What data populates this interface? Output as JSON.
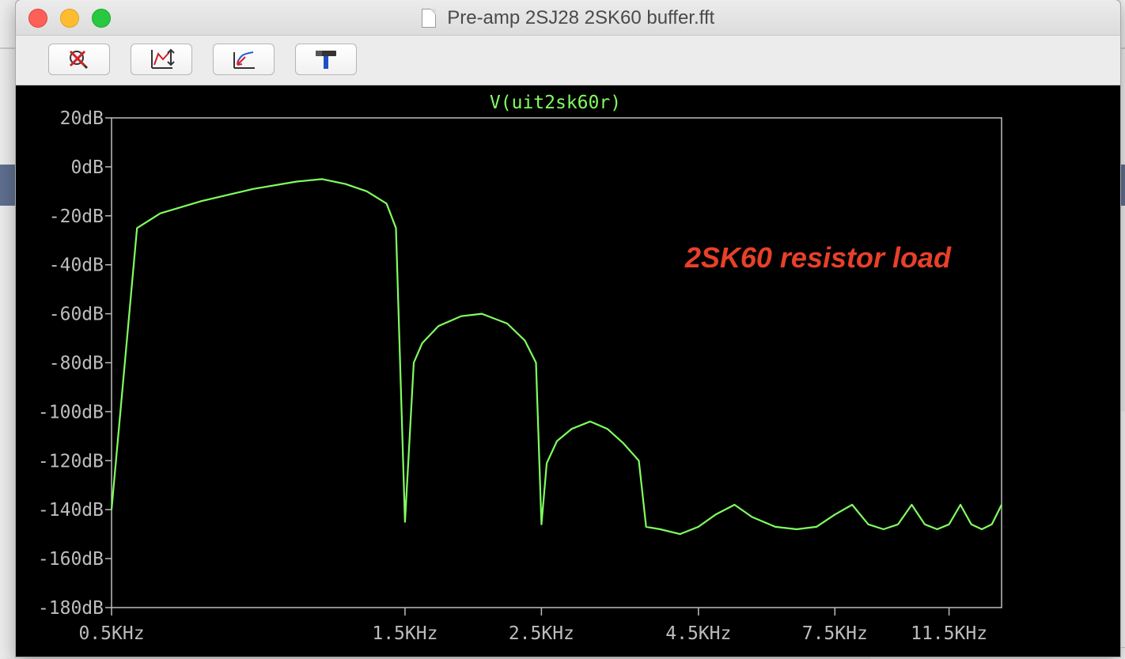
{
  "window": {
    "title": "Pre-amp 2SJ28 2SK60 buffer.fft"
  },
  "toolbar": {
    "buttons": [
      {
        "name": "zoom-cancel",
        "icon": "zoom-cancel-icon"
      },
      {
        "name": "autorange",
        "icon": "autorange-icon"
      },
      {
        "name": "pick-traces",
        "icon": "plot-traces-icon"
      },
      {
        "name": "settings",
        "icon": "hammer-icon"
      }
    ]
  },
  "colors": {
    "trace": "#80ff5f",
    "annotation": "#e8402a",
    "axis": "#bdbdbd",
    "background": "#000000"
  },
  "chart_data": {
    "type": "line",
    "title": "V(uit2sk60r)",
    "annotation": "2SK60 resistor load",
    "xlabel": "",
    "ylabel": "",
    "x_scale": "log",
    "xlim": [
      500,
      14000
    ],
    "ylim": [
      -180,
      20
    ],
    "grid": false,
    "y_ticks": [
      20,
      0,
      -20,
      -40,
      -60,
      -80,
      -100,
      -120,
      -140,
      -160,
      -180
    ],
    "y_tick_labels": [
      "20dB",
      "0dB",
      "-20dB",
      "-40dB",
      "-60dB",
      "-80dB",
      "-100dB",
      "-120dB",
      "-140dB",
      "-160dB",
      "-180dB"
    ],
    "x_ticks": [
      500,
      1500,
      2500,
      4500,
      7500,
      11500
    ],
    "x_tick_labels": [
      "0.5KHz",
      "1.5KHz",
      "2.5KHz",
      "4.5KHz",
      "7.5KHz",
      "11.5KHz"
    ],
    "series": [
      {
        "x": [
          500,
          550,
          600,
          700,
          850,
          1000,
          1100,
          1200,
          1300,
          1400,
          1450,
          1500,
          1550,
          1600,
          1700,
          1850,
          2000,
          2200,
          2350,
          2450,
          2500,
          2550,
          2650,
          2800,
          3000,
          3200,
          3400,
          3600,
          3700,
          3900,
          4200,
          4500,
          4800,
          5150,
          5500,
          6000,
          6500,
          7000,
          7500,
          8000,
          8500,
          9000,
          9500,
          10000,
          10500,
          11000,
          11500,
          12000,
          12500,
          13000,
          13500,
          14000
        ],
        "y": [
          -140,
          -25,
          -19,
          -14,
          -9,
          -6,
          -5,
          -7,
          -10,
          -15,
          -25,
          -145,
          -80,
          -72,
          -65,
          -61,
          -60,
          -64,
          -71,
          -80,
          -146,
          -121,
          -112,
          -107,
          -104,
          -107,
          -113,
          -120,
          -147,
          -148,
          -150,
          -147,
          -142,
          -138,
          -143,
          -147,
          -148,
          -147,
          -142,
          -138,
          -146,
          -148,
          -146,
          -138,
          -146,
          -148,
          -146,
          -138,
          -146,
          -148,
          -146,
          -138
        ]
      }
    ]
  }
}
